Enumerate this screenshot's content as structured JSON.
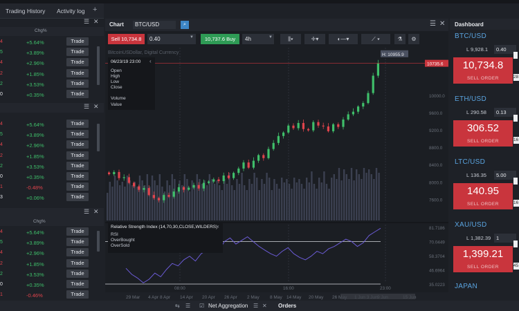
{
  "top_tabs": [
    "Trading History",
    "Activity log"
  ],
  "top_tab_add": "+",
  "markets": {
    "header_chg": "Chg%",
    "trade_label": "Trade",
    "groups": [
      {
        "rows": [
          {
            "left": "4",
            "chg": "+5.64%",
            "left_color": "neg",
            "chg_color": "pos"
          },
          {
            "left": "5",
            "chg": "+3.89%",
            "left_color": "pos",
            "chg_color": "pos"
          },
          {
            "left": "4",
            "chg": "+2.96%",
            "left_color": "neg",
            "chg_color": "pos"
          },
          {
            "left": "2",
            "chg": "+1.85%",
            "left_color": "neg",
            "chg_color": "pos"
          },
          {
            "left": "2",
            "chg": "+3.53%",
            "left_color": "pos",
            "chg_color": "pos"
          },
          {
            "left": "0",
            "chg": "+0.35%",
            "left_color": "neu",
            "chg_color": "pos"
          }
        ]
      },
      {
        "rows": [
          {
            "left": "4",
            "chg": "+5.64%",
            "left_color": "neg",
            "chg_color": "pos"
          },
          {
            "left": "5",
            "chg": "+3.89%",
            "left_color": "pos",
            "chg_color": "pos"
          },
          {
            "left": "4",
            "chg": "+2.96%",
            "left_color": "neg",
            "chg_color": "pos"
          },
          {
            "left": "2",
            "chg": "+1.85%",
            "left_color": "neg",
            "chg_color": "pos"
          },
          {
            "left": "2",
            "chg": "+3.53%",
            "left_color": "pos",
            "chg_color": "pos"
          },
          {
            "left": "0",
            "chg": "+0.35%",
            "left_color": "neu",
            "chg_color": "pos"
          },
          {
            "left": "1",
            "chg": "-0.48%",
            "left_color": "neg",
            "chg_color": "neg"
          },
          {
            "left": "3",
            "chg": "+0.06%",
            "left_color": "neu",
            "chg_color": "pos"
          }
        ]
      },
      {
        "rows": [
          {
            "left": "4",
            "chg": "+5.64%",
            "left_color": "neg",
            "chg_color": "pos"
          },
          {
            "left": "5",
            "chg": "+3.89%",
            "left_color": "pos",
            "chg_color": "pos"
          },
          {
            "left": "4",
            "chg": "+2.96%",
            "left_color": "neg",
            "chg_color": "pos"
          },
          {
            "left": "2",
            "chg": "+1.85%",
            "left_color": "neg",
            "chg_color": "pos"
          },
          {
            "left": "2",
            "chg": "+3.53%",
            "left_color": "pos",
            "chg_color": "pos"
          },
          {
            "left": "0",
            "chg": "+0.35%",
            "left_color": "neu",
            "chg_color": "pos"
          },
          {
            "left": "1",
            "chg": "-0.46%",
            "left_color": "neg",
            "chg_color": "neg"
          }
        ]
      }
    ]
  },
  "chart": {
    "title": "Chart",
    "symbol": "BTC/USD",
    "sell_label": "Sell 10,734.8",
    "quantity": "0.40",
    "buy_label": "10,737.6 Buy",
    "timeframe": "4h",
    "watermark": "BitcoinUSDollar, Digital Currency",
    "legend": {
      "datetime": "06/23/19 23:00",
      "fields": [
        "Open",
        "High",
        "Low",
        "Close"
      ],
      "volume_fields": [
        "Volume",
        "Value"
      ]
    },
    "high_tag": "H: 10955.9",
    "last_price_tag": "10735.6",
    "price_ticks": [
      "10000.0",
      "9600.0",
      "9200.0",
      "8800.0",
      "8400.0",
      "8000.0",
      "7600.0"
    ],
    "rsi_title": "Relative Strength Index (14,70,30,CLOSE,WILDERS)",
    "rsi_fields": [
      "RSI",
      "OverBought",
      "OverSold"
    ],
    "rsi_ticks": [
      "81.7186",
      "70.0449",
      "58.3704",
      "46.6964",
      "35.0223"
    ],
    "time_marks": [
      "08:00",
      "16:00",
      "23:00"
    ],
    "date_ticks": [
      "29 Mar",
      "4 Apr 8 Apr",
      "14 Apr",
      "20 Apr",
      "26 Apr",
      "2 May",
      "8 May",
      "14 May",
      "20 May",
      "26 May",
      "1 Jun 3 Jun",
      "9 Jun",
      "15 Jun"
    ]
  },
  "chart_data": {
    "type": "candlestick",
    "symbol": "BTC/USD",
    "timeframe": "4h",
    "price_range": [
      7400,
      11000
    ],
    "last_price": 10735.6,
    "high": 10955.9,
    "close_path": [
      8180,
      8230,
      8090,
      8110,
      7980,
      7900,
      7820,
      7860,
      7700,
      7630,
      7580,
      7700,
      7660,
      7780,
      7880,
      7820,
      7870,
      7930,
      7850,
      7980,
      8010,
      8060,
      8020,
      8150,
      8090,
      8210,
      8310,
      8450,
      8330,
      8490,
      8620,
      8550,
      8760,
      8900,
      9060,
      9140,
      9300,
      9240,
      9360,
      9220,
      9190,
      9380,
      9300,
      9280,
      9170,
      9330,
      9270,
      9440,
      9560,
      9620,
      9740,
      9820,
      10050,
      10450,
      10735.6
    ],
    "rsi_range": [
      35.0223,
      81.7186
    ],
    "rsi_levels": {
      "overbought": 70.0449,
      "oversold": 35.0223
    },
    "rsi_path": [
      48,
      43,
      40,
      36,
      39,
      44,
      41,
      47,
      52,
      50,
      55,
      58,
      54,
      60,
      63,
      66,
      62,
      70,
      73,
      68,
      71,
      74,
      70,
      66,
      63,
      60,
      58,
      62,
      65,
      60,
      57,
      55,
      58,
      62,
      60,
      64,
      66,
      69,
      72,
      70,
      66,
      69,
      75,
      78,
      81
    ]
  },
  "bottom": {
    "tab_net": "Net Aggregation",
    "tab_orders": "Orders"
  },
  "dashboard": {
    "title": "Dashboard",
    "sell_order": "SELL ORDER",
    "items": [
      {
        "symbol": "BTC/USD",
        "l": "L 9,928.1",
        "qty": "0.40",
        "price": "10,734.8",
        "side": "28"
      },
      {
        "symbol": "ETH/USD",
        "l": "L 290.58",
        "qty": "0.13",
        "price": "306.52",
        "side": "16"
      },
      {
        "symbol": "LTC/USD",
        "l": "L 136.35",
        "qty": "5.00",
        "price": "140.95",
        "side": "16"
      },
      {
        "symbol": "XAU/USD",
        "l": "L 1,382.39",
        "qty": "1",
        "price": "1,399.21",
        "side": "45"
      },
      {
        "symbol": "JAPAN",
        "l": "",
        "qty": "",
        "price": "",
        "side": ""
      }
    ]
  }
}
